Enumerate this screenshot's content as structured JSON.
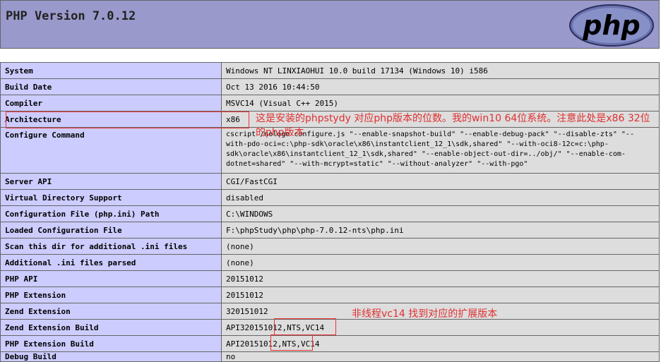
{
  "header": {
    "title": "PHP Version 7.0.12",
    "logo_text": "php"
  },
  "rows": [
    {
      "label": "System",
      "value": "Windows NT LINXIAOHUI 10.0 build 17134 (Windows 10) i586"
    },
    {
      "label": "Build Date",
      "value": "Oct 13 2016 10:44:50"
    },
    {
      "label": "Compiler",
      "value": "MSVC14 (Visual C++ 2015)"
    },
    {
      "label": "Architecture",
      "value": "x86"
    },
    {
      "label": "Configure Command",
      "value": "cscript /nologo configure.js \"--enable-snapshot-build\" \"--enable-debug-pack\" \"--disable-zts\" \"--with-pdo-oci=c:\\php-sdk\\oracle\\x86\\instantclient_12_1\\sdk,shared\" \"--with-oci8-12c=c:\\php-sdk\\oracle\\x86\\instantclient_12_1\\sdk,shared\" \"--enable-object-out-dir=../obj/\" \"--enable-com-dotnet=shared\" \"--with-mcrypt=static\" \"--without-analyzer\" \"--with-pgo\""
    },
    {
      "label": "Server API",
      "value": "CGI/FastCGI"
    },
    {
      "label": "Virtual Directory Support",
      "value": "disabled"
    },
    {
      "label": "Configuration File (php.ini) Path",
      "value": "C:\\WINDOWS"
    },
    {
      "label": "Loaded Configuration File",
      "value": "F:\\phpStudy\\php\\php-7.0.12-nts\\php.ini"
    },
    {
      "label": "Scan this dir for additional .ini files",
      "value": "(none)"
    },
    {
      "label": "Additional .ini files parsed",
      "value": "(none)"
    },
    {
      "label": "PHP API",
      "value": "20151012"
    },
    {
      "label": "PHP Extension",
      "value": "20151012"
    },
    {
      "label": "Zend Extension",
      "value": "320151012"
    },
    {
      "label": "Zend Extension Build",
      "value": "API320151012,NTS,VC14"
    },
    {
      "label": "PHP Extension Build",
      "value": "API20151012,NTS,VC14"
    },
    {
      "label": "Debug Build",
      "value": "no"
    }
  ],
  "annotations": {
    "arch_note": "这是安装的phpstydy 对应php版本的位数。我的win10 64位系统。注意此处是x86 32位的php版本",
    "build_note": "非线程vc14 找到对应的扩展版本"
  }
}
